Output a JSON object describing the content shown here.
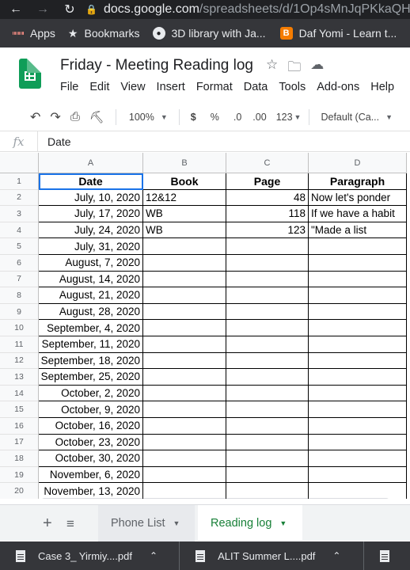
{
  "browser": {
    "url_host": "docs.google.com",
    "url_path": "/spreadsheets/d/1Op4sMnJqPKkaQH",
    "bookmarks": [
      "Apps",
      "Bookmarks",
      "3D library with Ja...",
      "Daf Yomi - Learn t..."
    ]
  },
  "doc": {
    "title": "Friday - Meeting Reading log",
    "menu": [
      "File",
      "Edit",
      "View",
      "Insert",
      "Format",
      "Data",
      "Tools",
      "Add-ons",
      "Help"
    ]
  },
  "toolbar": {
    "zoom": "100%",
    "currency": "$",
    "percent": "%",
    "dec_decrease": ".0",
    "dec_increase": ".00",
    "more_formats": "123",
    "font": "Default (Ca..."
  },
  "formula": {
    "fx": "fx",
    "value": "Date"
  },
  "columns": [
    "A",
    "B",
    "C",
    "D"
  ],
  "header_row": [
    "Date",
    "Book",
    "Page",
    "Paragraph"
  ],
  "rows": [
    {
      "n": "2",
      "date": "July, 10, 2020",
      "book": "12&12",
      "page": "48",
      "para": "Now let's ponder"
    },
    {
      "n": "3",
      "date": "July, 17, 2020",
      "book": "WB",
      "page": "118",
      "para": "If we have a habit"
    },
    {
      "n": "4",
      "date": "July, 24, 2020",
      "book": "WB",
      "page": "123",
      "para": "\"Made a list"
    },
    {
      "n": "5",
      "date": "July, 31, 2020",
      "book": "",
      "page": "",
      "para": ""
    },
    {
      "n": "6",
      "date": "August, 7, 2020",
      "book": "",
      "page": "",
      "para": ""
    },
    {
      "n": "7",
      "date": "August, 14, 2020",
      "book": "",
      "page": "",
      "para": ""
    },
    {
      "n": "8",
      "date": "August, 21, 2020",
      "book": "",
      "page": "",
      "para": ""
    },
    {
      "n": "9",
      "date": "August, 28, 2020",
      "book": "",
      "page": "",
      "para": ""
    },
    {
      "n": "10",
      "date": "September, 4, 2020",
      "book": "",
      "page": "",
      "para": ""
    },
    {
      "n": "11",
      "date": "September, 11, 2020",
      "book": "",
      "page": "",
      "para": ""
    },
    {
      "n": "12",
      "date": "September, 18, 2020",
      "book": "",
      "page": "",
      "para": ""
    },
    {
      "n": "13",
      "date": "September, 25, 2020",
      "book": "",
      "page": "",
      "para": ""
    },
    {
      "n": "14",
      "date": "October, 2, 2020",
      "book": "",
      "page": "",
      "para": ""
    },
    {
      "n": "15",
      "date": "October, 9, 2020",
      "book": "",
      "page": "",
      "para": ""
    },
    {
      "n": "16",
      "date": "October, 16, 2020",
      "book": "",
      "page": "",
      "para": ""
    },
    {
      "n": "17",
      "date": "October, 23, 2020",
      "book": "",
      "page": "",
      "para": ""
    },
    {
      "n": "18",
      "date": "October, 30, 2020",
      "book": "",
      "page": "",
      "para": ""
    },
    {
      "n": "19",
      "date": "November, 6, 2020",
      "book": "",
      "page": "",
      "para": ""
    },
    {
      "n": "20",
      "date": "November, 13, 2020",
      "book": "",
      "page": "",
      "para": ""
    }
  ],
  "sheets": {
    "inactive": "Phone List",
    "active": "Reading log"
  },
  "downloads": [
    "Case 3_ Yirmiy....pdf",
    "ALIT Summer L....pdf"
  ],
  "colors": {
    "sheets_green": "#0f9d58",
    "active_tab": "#188038",
    "selection": "#1a73e8"
  }
}
